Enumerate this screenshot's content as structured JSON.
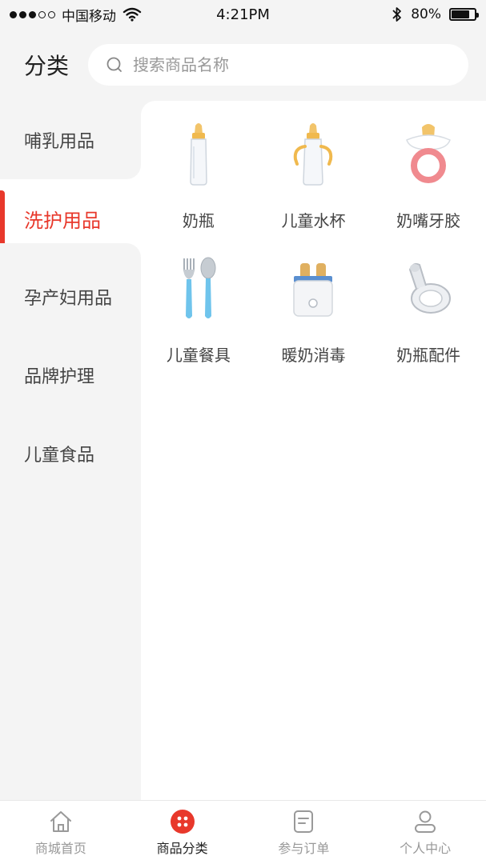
{
  "status_bar": {
    "carrier": "中国移动",
    "time": "4:21PM",
    "battery": "80%",
    "battery_level": 0.8
  },
  "header": {
    "title": "分类",
    "search_placeholder": "搜索商品名称"
  },
  "sidebar": {
    "items": [
      {
        "label": "哺乳用品"
      },
      {
        "label": "洗护用品",
        "active": true
      },
      {
        "label": "孕产妇用品"
      },
      {
        "label": "品牌护理"
      },
      {
        "label": "儿童食品"
      }
    ]
  },
  "products": [
    {
      "name": "奶瓶",
      "icon": "baby-bottle-icon"
    },
    {
      "name": "儿童水杯",
      "icon": "sippy-cup-icon"
    },
    {
      "name": "奶嘴牙胶",
      "icon": "pacifier-icon"
    },
    {
      "name": "儿童餐具",
      "icon": "cutlery-icon"
    },
    {
      "name": "暖奶消毒",
      "icon": "bottle-warmer-icon"
    },
    {
      "name": "奶瓶配件",
      "icon": "nipple-icon"
    }
  ],
  "tabbar": {
    "items": [
      {
        "label": "商城首页",
        "icon": "home-icon"
      },
      {
        "label": "商品分类",
        "icon": "category-icon",
        "active": true
      },
      {
        "label": "参与订单",
        "icon": "order-icon"
      },
      {
        "label": "个人中心",
        "icon": "user-icon"
      }
    ]
  },
  "colors": {
    "accent": "#e8382b",
    "background": "#f4f4f4"
  }
}
